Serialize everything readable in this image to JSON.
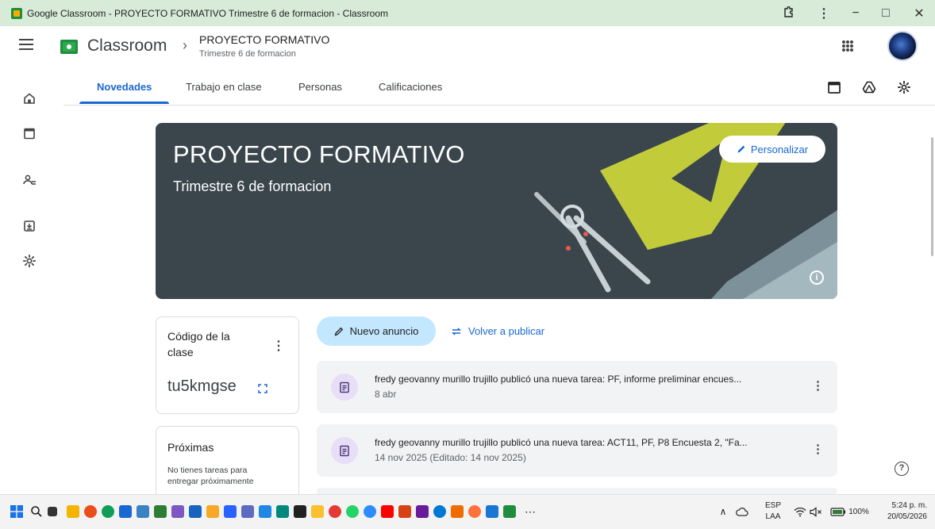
{
  "window": {
    "title": "Google Classroom - PROYECTO FORMATIVO Trimestre 6 de formacion - Classroom",
    "controls": [
      "−",
      "□",
      "✕"
    ]
  },
  "header": {
    "brand": "Classroom",
    "separator": "›",
    "course_title": "PROYECTO FORMATIVO",
    "course_subtitle": "Trimestre 6 de formacion"
  },
  "tabs": [
    {
      "label": "Novedades",
      "active": true
    },
    {
      "label": "Trabajo en clase",
      "active": false
    },
    {
      "label": "Personas",
      "active": false
    },
    {
      "label": "Calificaciones",
      "active": false
    }
  ],
  "banner": {
    "title": "PROYECTO FORMATIVO",
    "subtitle": "Trimestre 6 de formacion",
    "customize_label": "Personalizar",
    "info_glyph": "i"
  },
  "class_code": {
    "label": "Código de la clase",
    "menu_glyph": "⋮",
    "code": "tu5kmgse"
  },
  "upcoming": {
    "title": "Próximas",
    "text": "No tienes tareas para entregar próximamente"
  },
  "actions": {
    "new_announcement": "Nuevo anuncio",
    "repost": "Volver a publicar"
  },
  "stream": [
    {
      "text": "fredy geovanny murillo trujillo publicó una nueva tarea: PF, informe preliminar encues...",
      "date": "8 abr"
    },
    {
      "text": "fredy geovanny murillo trujillo publicó una nueva tarea: ACT11, PF, P8 Encuesta 2, \"Fa...",
      "date": "14 nov 2025 (Editado: 14 nov 2025)"
    }
  ],
  "help_glyph": "?",
  "post_menu_glyph": "⋮",
  "taskbar": {
    "language": "ESP",
    "language_sub": "LAA",
    "battery": "100%",
    "time": "5:24 p. m.",
    "date": "20/05/2026",
    "overflow": "⋯",
    "tray_arrow": "∧"
  },
  "colors": {
    "titlebar": "#d7ebd8",
    "accent": "#1967d2",
    "banner": "#3a464c",
    "button_bg": "#c2e7ff",
    "post_bg": "#f1f3f4",
    "assignment_icon_bg": "#e8def8"
  }
}
